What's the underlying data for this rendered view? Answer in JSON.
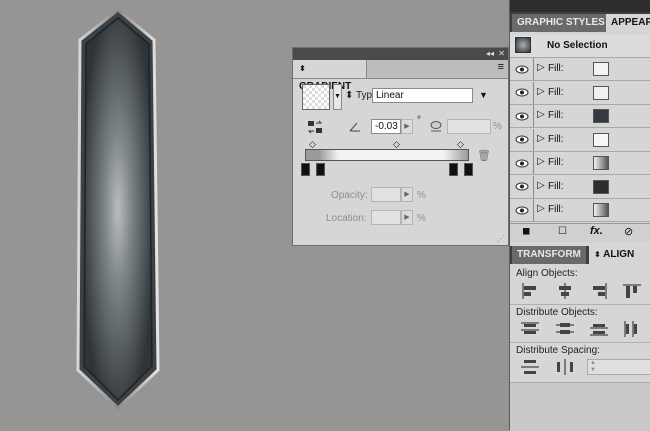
{
  "gradient_panel": {
    "tab_label": "GRADIENT",
    "type_label": "Type:",
    "type_value": "Linear",
    "angle_value": "-0.03",
    "degree_symbol": "°",
    "percent_symbol": "%",
    "opacity_label": "Opacity:",
    "location_label": "Location:"
  },
  "styles_panel": {
    "tab_styles": "GRAPHIC STYLES",
    "tab_appearance": "APPEAR",
    "selection_label": "No Selection",
    "fill_rows": [
      {
        "label": "Fill:",
        "swatch": "#f4f4f4"
      },
      {
        "label": "Fill:",
        "swatch": "#f0f0f0"
      },
      {
        "label": "Fill:",
        "swatch": "#343a40"
      },
      {
        "label": "Fill:",
        "swatch": "#f6f6f6"
      },
      {
        "label": "Fill:",
        "swatch": "gradient"
      },
      {
        "label": "Fill:",
        "swatch": "#2e2e30"
      },
      {
        "label": "Fill:",
        "swatch": "gradient"
      }
    ]
  },
  "align_panel": {
    "tab_transform": "TRANSFORM",
    "tab_align": "ALIGN",
    "align_objects_label": "Align Objects:",
    "distribute_objects_label": "Distribute Objects:",
    "distribute_spacing_label": "Distribute Spacing:"
  },
  "colors": {
    "canvas": "#979594",
    "panel": "#d6d6d6",
    "dark_tab": "#3f3f3f"
  }
}
